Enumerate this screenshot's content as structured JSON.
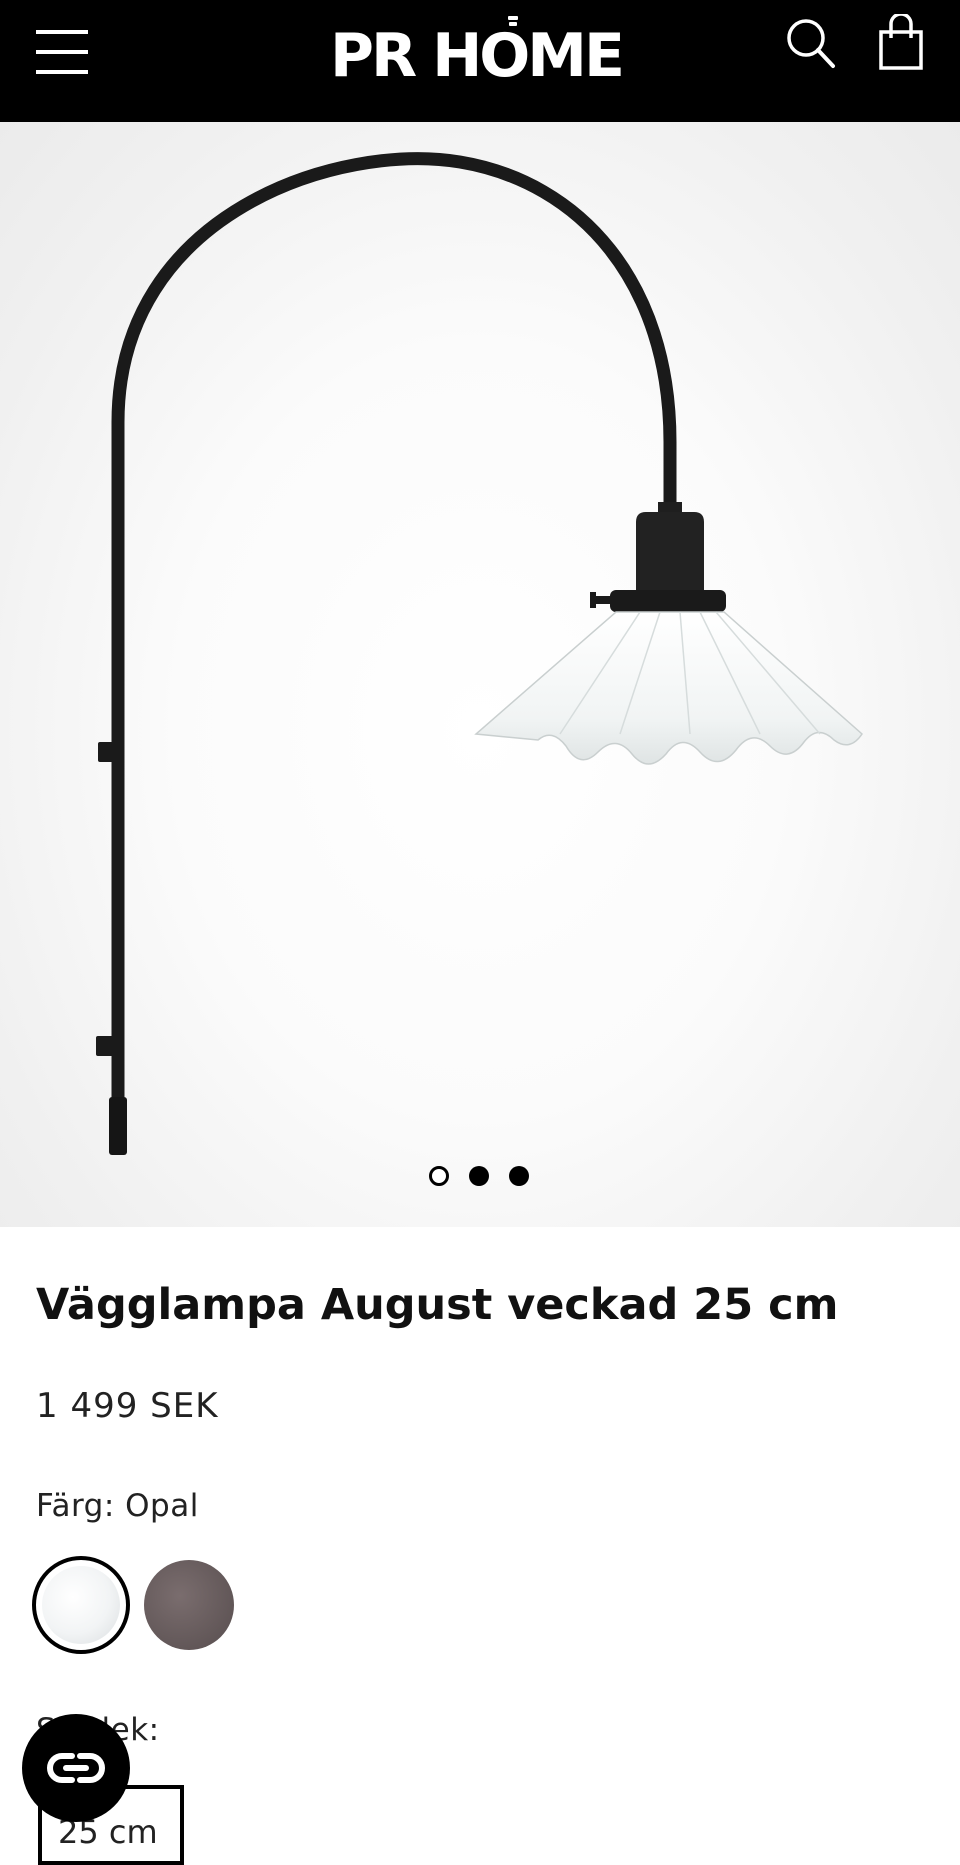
{
  "header": {
    "logo_text": "PR HOME",
    "menu_icon": "hamburger-menu-icon",
    "search_icon": "search-icon",
    "cart_icon": "shopping-bag-icon",
    "background": "#000000"
  },
  "gallery": {
    "image_alt": "Vägglampa August veckad 25 cm",
    "slide_count": 3,
    "active_slide": 1
  },
  "product": {
    "title": "Vägglampa August veckad 25 cm",
    "price": "1 499 SEK",
    "color_label": "Färg: Opal",
    "swatches": [
      {
        "name": "Opal",
        "selected": true,
        "color": "#f2f4f5"
      },
      {
        "name": "Smoke",
        "selected": false,
        "color": "#655a5b"
      }
    ],
    "size_label": "Storlek:",
    "sizes": [
      "25 cm"
    ]
  },
  "chat": {
    "icon": "chat-widget-icon"
  }
}
